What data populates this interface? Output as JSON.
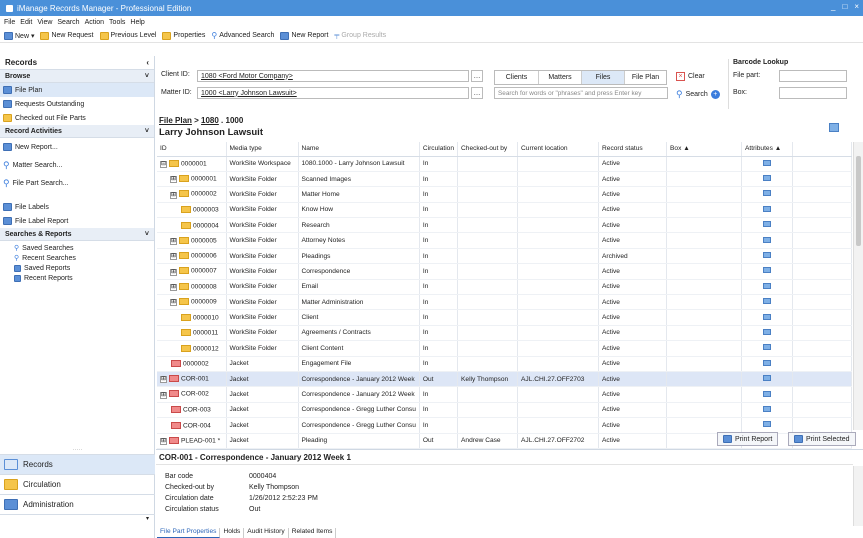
{
  "window": {
    "title": "iManage Records Manager - Professional Edition",
    "controls": [
      "_",
      "□",
      "×"
    ]
  },
  "menu": [
    "File",
    "Edit",
    "View",
    "Search",
    "Action",
    "Tools",
    "Help"
  ],
  "toolbar": {
    "new": "New ▾",
    "new_request": "New Request",
    "previous_level": "Previous Level",
    "properties": "Properties",
    "advanced_search": "Advanced Search",
    "new_report": "New Report",
    "group_results": "Group Results"
  },
  "sidebar": {
    "records_header": "Records",
    "browse_header": "Browse",
    "browse_items": [
      "File Plan",
      "Requests Outstanding",
      "Checked out File Parts"
    ],
    "activities_header": "Record Activities",
    "activity_items": [
      "New Report...",
      "Matter Search...",
      "File Part Search..."
    ],
    "label_items": [
      "File Labels",
      "File Label Report"
    ],
    "searches_header": "Searches & Reports",
    "search_items": [
      "Saved Searches",
      "Recent Searches",
      "Saved Reports",
      "Recent Reports"
    ],
    "nav": [
      "Records",
      "Circulation",
      "Administration"
    ]
  },
  "filter": {
    "client_label": "Client ID:",
    "client_value": "1080 <Ford Motor Company>",
    "matter_label": "Matter ID:",
    "matter_value": "1000 <Larry Johnson Lawsuit>",
    "tabs": [
      "Clients",
      "Matters",
      "Files",
      "File Plan"
    ],
    "clear": "Clear",
    "search_placeholder": "Search for words or \"phrases\" and press Enter key",
    "search": "Search",
    "barcode_header": "Barcode Lookup",
    "file_part_label": "File part:",
    "box_label": "Box:"
  },
  "breadcrumb": {
    "root": "File Plan",
    "sep": " > ",
    "level1": "1080",
    "level2": " . 1000"
  },
  "page_title": "Larry Johnson Lawsuit",
  "grid": {
    "columns": [
      "ID",
      "Media type",
      "Name",
      "Circulation",
      "Checked-out by",
      "Current location",
      "Record status",
      "Box ▲",
      "Attributes ▲"
    ],
    "rows": [
      {
        "exp": "⊟",
        "icon": "folder",
        "id": "0000001",
        "media": "WorkSite Workspace",
        "name": "1080.1000 - Larry Johnson Lawsuit",
        "circ": "In",
        "by": "",
        "loc": "",
        "status": "Active",
        "box": ""
      },
      {
        "exp": "⊞",
        "icon": "folder",
        "id": "0000001",
        "media": "WorkSite Folder",
        "name": "Scanned Images",
        "circ": "In",
        "by": "",
        "loc": "",
        "status": "Active",
        "box": ""
      },
      {
        "exp": "⊞",
        "icon": "folder",
        "id": "0000002",
        "media": "WorkSite Folder",
        "name": "Matter Home",
        "circ": "In",
        "by": "",
        "loc": "",
        "status": "Active",
        "box": ""
      },
      {
        "exp": "",
        "icon": "folder",
        "id": "0000003",
        "media": "WorkSite Folder",
        "name": "Know How",
        "circ": "In",
        "by": "",
        "loc": "",
        "status": "Active",
        "box": ""
      },
      {
        "exp": "",
        "icon": "folder",
        "id": "0000004",
        "media": "WorkSite Folder",
        "name": "Research",
        "circ": "In",
        "by": "",
        "loc": "",
        "status": "Active",
        "box": ""
      },
      {
        "exp": "⊞",
        "icon": "folder",
        "id": "0000005",
        "media": "WorkSite Folder",
        "name": "Attorney Notes",
        "circ": "In",
        "by": "",
        "loc": "",
        "status": "Active",
        "box": ""
      },
      {
        "exp": "⊞",
        "icon": "folder",
        "id": "0000006",
        "media": "WorkSite Folder",
        "name": "Pleadings",
        "circ": "In",
        "by": "",
        "loc": "",
        "status": "Archived",
        "box": ""
      },
      {
        "exp": "⊞",
        "icon": "folder",
        "id": "0000007",
        "media": "WorkSite Folder",
        "name": "Correspondence",
        "circ": "In",
        "by": "",
        "loc": "",
        "status": "Active",
        "box": ""
      },
      {
        "exp": "⊞",
        "icon": "folder",
        "id": "0000008",
        "media": "WorkSite Folder",
        "name": "Email",
        "circ": "In",
        "by": "",
        "loc": "",
        "status": "Active",
        "box": ""
      },
      {
        "exp": "⊞",
        "icon": "folder",
        "id": "0000009",
        "media": "WorkSite Folder",
        "name": "Matter Administration",
        "circ": "In",
        "by": "",
        "loc": "",
        "status": "Active",
        "box": ""
      },
      {
        "exp": "",
        "icon": "folder",
        "id": "0000010",
        "media": "WorkSite Folder",
        "name": "Client",
        "circ": "In",
        "by": "",
        "loc": "",
        "status": "Active",
        "box": ""
      },
      {
        "exp": "",
        "icon": "folder",
        "id": "0000011",
        "media": "WorkSite Folder",
        "name": "Agreements / Contracts",
        "circ": "In",
        "by": "",
        "loc": "",
        "status": "Active",
        "box": ""
      },
      {
        "exp": "",
        "icon": "folder",
        "id": "0000012",
        "media": "WorkSite Folder",
        "name": "Client Content",
        "circ": "In",
        "by": "",
        "loc": "",
        "status": "Active",
        "box": ""
      },
      {
        "exp": "",
        "icon": "jacket",
        "id": "0000002",
        "media": "Jacket",
        "name": "Engagement File",
        "circ": "In",
        "by": "",
        "loc": "",
        "status": "Active",
        "box": ""
      },
      {
        "exp": "⊞",
        "icon": "jacket",
        "id": "COR-001",
        "media": "Jacket",
        "name": "Correspondence - January 2012 Week",
        "circ": "Out",
        "by": "Kelly Thompson",
        "loc": "AJL.CHI.27.OFF2703",
        "status": "Active",
        "box": "",
        "selected": true
      },
      {
        "exp": "⊞",
        "icon": "jacket",
        "id": "COR-002",
        "media": "Jacket",
        "name": "Correspondence - January 2012 Week",
        "circ": "In",
        "by": "",
        "loc": "",
        "status": "Active",
        "box": ""
      },
      {
        "exp": "",
        "icon": "jacket",
        "id": "COR-003",
        "media": "Jacket",
        "name": "Correspondence - Gregg Luther Consu",
        "circ": "In",
        "by": "",
        "loc": "",
        "status": "Active",
        "box": ""
      },
      {
        "exp": "",
        "icon": "jacket",
        "id": "COR-004",
        "media": "Jacket",
        "name": "Correspondence - Gregg Luther Consu",
        "circ": "In",
        "by": "",
        "loc": "",
        "status": "Active",
        "box": ""
      },
      {
        "exp": "⊞",
        "icon": "jacket",
        "id": "PLEAD-001 *",
        "media": "Jacket",
        "name": "Pleading",
        "circ": "Out",
        "by": "Andrew Case",
        "loc": "AJL.CHI.27.OFF2702",
        "status": "Active",
        "box": ""
      }
    ]
  },
  "buttons": {
    "print_report": "Print Report",
    "print_selected": "Print Selected"
  },
  "details": {
    "title": "COR-001 - Correspondence - January 2012 Week 1",
    "fields": [
      {
        "label": "Bar code",
        "value": "0000404"
      },
      {
        "label": "Checked-out by",
        "value": "Kelly Thompson"
      },
      {
        "label": "Circulation date",
        "value": "1/26/2012 2:52:23 PM"
      },
      {
        "label": "Circulation status",
        "value": "Out"
      }
    ],
    "tabs": [
      "File Part Properties",
      "Holds",
      "Audit History",
      "Related Items"
    ]
  },
  "colors": {
    "titlebar": "#4a90d9",
    "selected_row": "#dde6f6",
    "folder": "#f5c54a",
    "jacket": "#f08a8a",
    "clear_icon": "#d9534f",
    "search_icon": "#3b7ddd"
  }
}
